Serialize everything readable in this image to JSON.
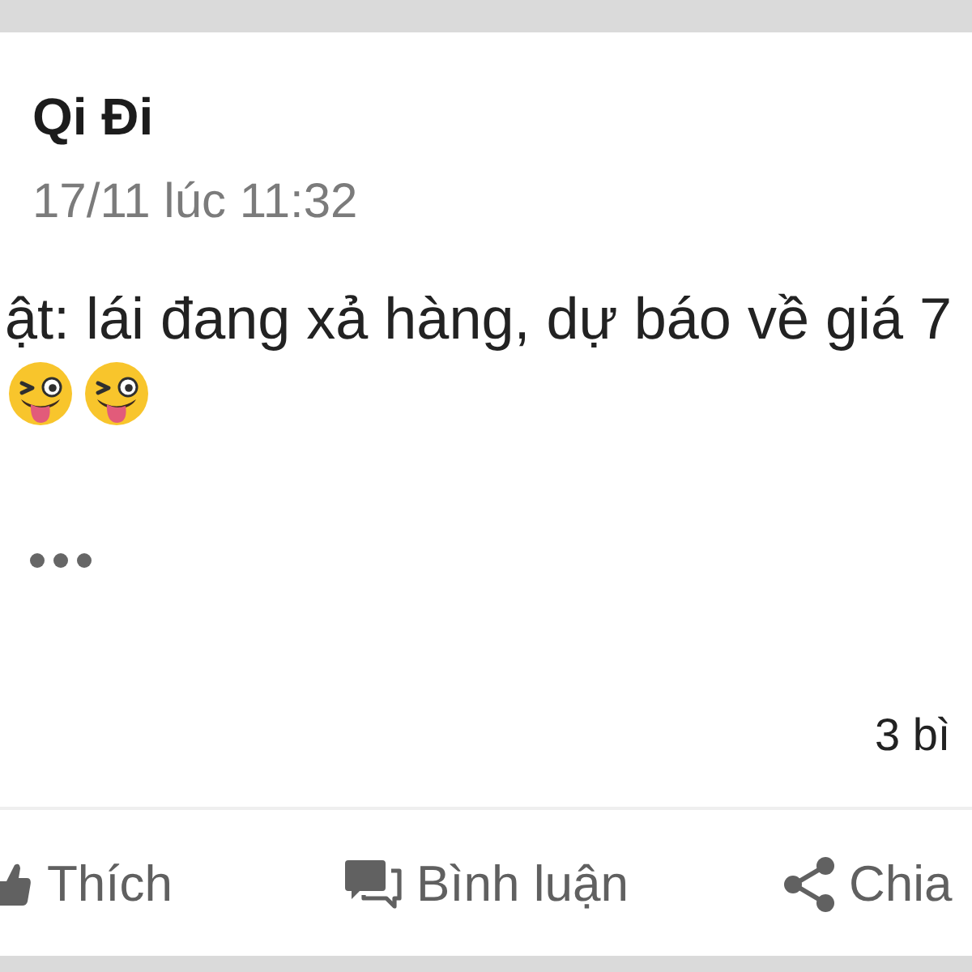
{
  "post": {
    "author": "Qi Đi",
    "timestamp": "17/11 lúc 11:32",
    "text": "ật: lái đang xả hàng, dự báo về giá 7",
    "emojis": [
      {
        "kind": "wink-tongue"
      },
      {
        "kind": "wink-tongue"
      }
    ],
    "truncated": true,
    "comment_count": "3 bì"
  },
  "actions": [
    {
      "kind": "like",
      "label": "Thích"
    },
    {
      "kind": "comment",
      "label": "Bình luận"
    },
    {
      "kind": "share",
      "label": "Chia"
    }
  ]
}
